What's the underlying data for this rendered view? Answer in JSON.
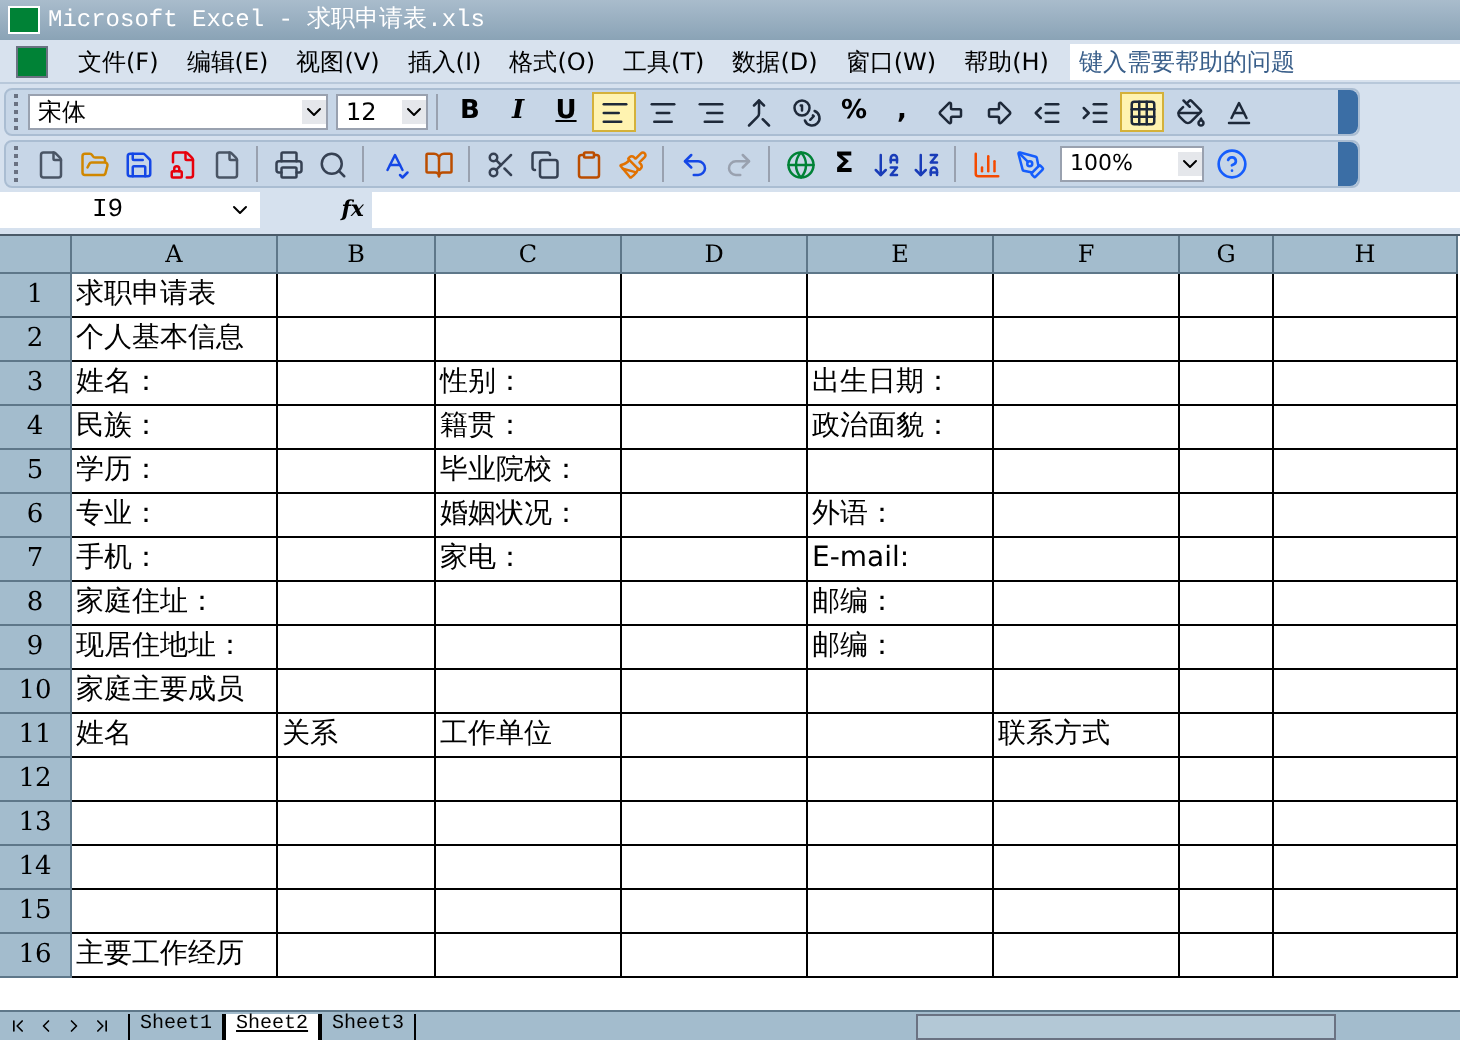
{
  "window": {
    "title": "Microsoft Excel - 求职申请表.xls"
  },
  "menu": [
    "文件(F)",
    "编辑(E)",
    "视图(V)",
    "插入(I)",
    "格式(O)",
    "工具(T)",
    "数据(D)",
    "窗口(W)",
    "帮助(H)"
  ],
  "help_box": {
    "placeholder": "键入需要帮助的问题"
  },
  "format_toolbar": {
    "font": "宋体",
    "size": "12",
    "buttons": [
      {
        "kind": "text",
        "label": "B",
        "selected": false
      },
      {
        "kind": "text",
        "label": "I",
        "selected": false
      },
      {
        "kind": "text",
        "label": "U",
        "selected": false
      },
      {
        "kind": "icon",
        "selected": true
      },
      {
        "kind": "icon",
        "selected": false
      },
      {
        "kind": "icon",
        "selected": false
      },
      {
        "kind": "icon",
        "selected": false
      },
      {
        "kind": "icon",
        "selected": false
      },
      {
        "kind": "text",
        "label": "%",
        "selected": false
      },
      {
        "kind": "text",
        "label": ",",
        "selected": false
      },
      {
        "kind": "icon",
        "selected": false
      },
      {
        "kind": "icon",
        "selected": false
      },
      {
        "kind": "icon",
        "selected": false
      },
      {
        "kind": "icon",
        "selected": false
      },
      {
        "kind": "icon",
        "selected": true
      },
      {
        "kind": "icon",
        "selected": false
      },
      {
        "kind": "icon",
        "selected": false
      }
    ]
  },
  "standard_toolbar": {
    "sum": "Σ",
    "zoom": "100%"
  },
  "formula_bar": {
    "name_box": "I9",
    "fx": "fx"
  },
  "columns": [
    "A",
    "B",
    "C",
    "D",
    "E",
    "F",
    "G",
    "H"
  ],
  "rows": [
    {
      "number": "1",
      "cells": [
        "求职申请表",
        null,
        null,
        null,
        null,
        null,
        null,
        null
      ]
    },
    {
      "number": "2",
      "cells": [
        "个人基本信息",
        null,
        null,
        null,
        null,
        null,
        null,
        null
      ]
    },
    {
      "number": "3",
      "cells": [
        "姓名：",
        null,
        "性别：",
        null,
        "出生日期：",
        null,
        null,
        null
      ]
    },
    {
      "number": "4",
      "cells": [
        "民族：",
        null,
        "籍贯：",
        null,
        "政治面貌：",
        null,
        null,
        null
      ]
    },
    {
      "number": "5",
      "cells": [
        "学历：",
        null,
        "毕业院校：",
        null,
        null,
        null,
        null,
        null
      ]
    },
    {
      "number": "6",
      "cells": [
        "专业：",
        null,
        "婚姻状况：",
        null,
        "外语：",
        null,
        null,
        null
      ]
    },
    {
      "number": "7",
      "cells": [
        "手机：",
        null,
        "家电：",
        null,
        "E-mail:",
        null,
        null,
        null
      ]
    },
    {
      "number": "8",
      "cells": [
        "家庭住址：",
        null,
        null,
        null,
        "邮编：",
        null,
        null,
        null
      ]
    },
    {
      "number": "9",
      "cells": [
        "现居住地址：",
        null,
        null,
        null,
        "邮编：",
        null,
        null,
        null
      ]
    },
    {
      "number": "10",
      "cells": [
        "家庭主要成员",
        null,
        null,
        null,
        null,
        null,
        null,
        null
      ]
    },
    {
      "number": "11",
      "cells": [
        "姓名",
        "关系",
        "工作单位",
        null,
        null,
        "联系方式",
        null,
        null
      ]
    },
    {
      "number": "12",
      "cells": [
        null,
        null,
        null,
        null,
        null,
        null,
        null,
        null
      ]
    },
    {
      "number": "13",
      "cells": [
        null,
        null,
        null,
        null,
        null,
        null,
        null,
        null
      ]
    },
    {
      "number": "14",
      "cells": [
        null,
        null,
        null,
        null,
        null,
        null,
        null,
        null
      ]
    },
    {
      "number": "15",
      "cells": [
        null,
        null,
        null,
        null,
        null,
        null,
        null,
        null
      ]
    },
    {
      "number": "16",
      "cells": [
        "主要工作经历",
        null,
        null,
        null,
        null,
        null,
        null,
        null
      ]
    }
  ],
  "sheets": [
    {
      "label": "Sheet1",
      "selected": false
    },
    {
      "label": "Sheet2",
      "selected": true
    },
    {
      "label": "Sheet3",
      "selected": false
    }
  ]
}
